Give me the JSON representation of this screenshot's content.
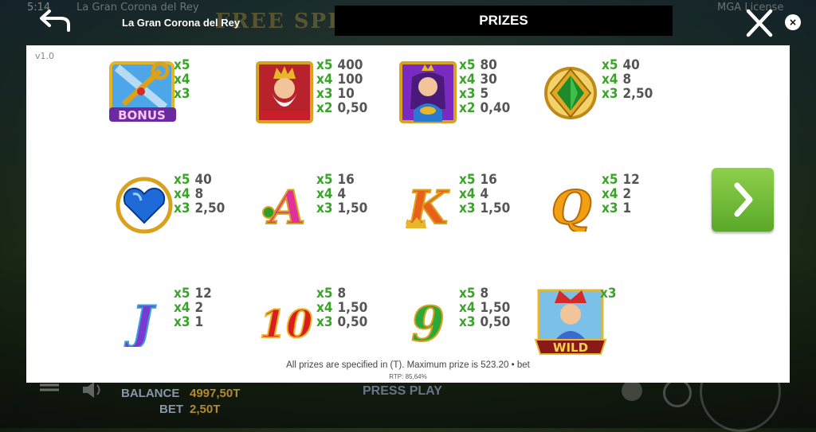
{
  "status": {
    "time": "5:14",
    "game_subtitle": "La Gran Corona del Rey",
    "license": "MGA License",
    "version": "v1.0"
  },
  "background_title": "FREE SPINS",
  "header": {
    "game_name": "La Gran Corona del Rey",
    "title": "PRIZES"
  },
  "colors": {
    "multiplier": "#3aa42a",
    "value": "#555555",
    "next_button": "#6cbb36",
    "header_bar": "#000000"
  },
  "symbols": [
    {
      "name": "bonus",
      "icon": "bonus-key-icon",
      "label": "BONUS",
      "pays": [
        {
          "m": "x5",
          "v": ""
        },
        {
          "m": "x4",
          "v": ""
        },
        {
          "m": "x3",
          "v": ""
        }
      ]
    },
    {
      "name": "king",
      "icon": "king-icon",
      "pays": [
        {
          "m": "x5",
          "v": "400"
        },
        {
          "m": "x4",
          "v": "100"
        },
        {
          "m": "x3",
          "v": "10"
        },
        {
          "m": "x2",
          "v": "0,50"
        }
      ]
    },
    {
      "name": "queen",
      "icon": "queen-icon",
      "pays": [
        {
          "m": "x5",
          "v": "80"
        },
        {
          "m": "x4",
          "v": "30"
        },
        {
          "m": "x3",
          "v": "5"
        },
        {
          "m": "x2",
          "v": "0,40"
        }
      ]
    },
    {
      "name": "emerald",
      "icon": "emerald-gem-icon",
      "pays": [
        {
          "m": "x5",
          "v": "40"
        },
        {
          "m": "x4",
          "v": "8"
        },
        {
          "m": "x3",
          "v": "2,50"
        }
      ]
    },
    {
      "name": "sapphire-heart",
      "icon": "sapphire-heart-icon",
      "pays": [
        {
          "m": "x5",
          "v": "40"
        },
        {
          "m": "x4",
          "v": "8"
        },
        {
          "m": "x3",
          "v": "2,50"
        }
      ]
    },
    {
      "name": "ace",
      "icon": "letter-a-icon",
      "label": "A",
      "pays": [
        {
          "m": "x5",
          "v": "16"
        },
        {
          "m": "x4",
          "v": "4"
        },
        {
          "m": "x3",
          "v": "1,50"
        }
      ]
    },
    {
      "name": "king-letter",
      "icon": "letter-k-icon",
      "label": "K",
      "pays": [
        {
          "m": "x5",
          "v": "16"
        },
        {
          "m": "x4",
          "v": "4"
        },
        {
          "m": "x3",
          "v": "1,50"
        }
      ]
    },
    {
      "name": "queen-letter",
      "icon": "letter-q-icon",
      "label": "Q",
      "pays": [
        {
          "m": "x5",
          "v": "12"
        },
        {
          "m": "x4",
          "v": "2"
        },
        {
          "m": "x3",
          "v": "1"
        }
      ]
    },
    {
      "name": "jack",
      "icon": "letter-j-icon",
      "label": "J",
      "pays": [
        {
          "m": "x5",
          "v": "12"
        },
        {
          "m": "x4",
          "v": "2"
        },
        {
          "m": "x3",
          "v": "1"
        }
      ]
    },
    {
      "name": "ten",
      "icon": "number-10-icon",
      "label": "10",
      "pays": [
        {
          "m": "x5",
          "v": "8"
        },
        {
          "m": "x4",
          "v": "1,50"
        },
        {
          "m": "x3",
          "v": "0,50"
        }
      ]
    },
    {
      "name": "nine",
      "icon": "number-9-icon",
      "label": "9",
      "pays": [
        {
          "m": "x5",
          "v": "8"
        },
        {
          "m": "x4",
          "v": "1,50"
        },
        {
          "m": "x3",
          "v": "0,50"
        }
      ]
    },
    {
      "name": "wild",
      "icon": "jester-wild-icon",
      "label": "WILD",
      "pays": [
        {
          "m": "x3",
          "v": ""
        }
      ]
    }
  ],
  "footer": {
    "note": "All prizes are specified in (T). Maximum prize is 523.20 • bet",
    "rtp": "RTP: 85,64%"
  },
  "bottom_bar": {
    "balance_label": "BALANCE",
    "balance_value": "4997,50T",
    "bet_label": "BET",
    "bet_value": "2,50T",
    "press_play": "PRESS PLAY"
  }
}
